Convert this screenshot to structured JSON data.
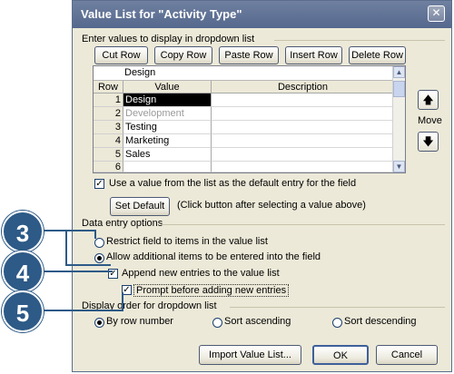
{
  "dialog": {
    "title": "Value List for \"Activity Type\"",
    "close_glyph": "✕"
  },
  "values_section": {
    "label": "Enter values to display in dropdown list",
    "buttons": [
      "Cut Row",
      "Copy Row",
      "Paste Row",
      "Insert Row",
      "Delete Row"
    ]
  },
  "grid": {
    "edit_value": "Design",
    "columns": [
      "Row",
      "Value",
      "Description"
    ],
    "rows": [
      {
        "num": "1",
        "value": "Design",
        "selected": true
      },
      {
        "num": "2",
        "value": "Development",
        "grayed": true
      },
      {
        "num": "3",
        "value": "Testing"
      },
      {
        "num": "4",
        "value": "Marketing"
      },
      {
        "num": "5",
        "value": "Sales"
      },
      {
        "num": "6",
        "value": ""
      }
    ]
  },
  "move": {
    "label": "Move",
    "up_glyph": "🡅",
    "down_glyph": "🡇"
  },
  "default_option": {
    "checkbox_label": "Use a value from the list as the default entry for the field",
    "checked": true,
    "set_default_button": "Set Default",
    "hint": "(Click button after selecting a value above)"
  },
  "data_entry": {
    "label": "Data entry options",
    "restrict_label": "Restrict field to items in the value list",
    "allow_label": "Allow additional items to be entered into the field",
    "append_label": "Append new entries to the value list",
    "prompt_label": "Prompt before adding new entries",
    "selected": "allow",
    "append_checked": true,
    "prompt_checked": true
  },
  "display_order": {
    "label": "Display order for dropdown list",
    "options": [
      "By row number",
      "Sort ascending",
      "Sort descending"
    ],
    "selected": "By row number"
  },
  "footer": {
    "import_button": "Import Value List...",
    "ok_button": "OK",
    "cancel_button": "Cancel"
  },
  "callouts": [
    "3",
    "4",
    "5"
  ],
  "colors": {
    "callout": "#2d5a87",
    "titlebar": "#6f80a0",
    "dialog_bg": "#ece9d8"
  }
}
